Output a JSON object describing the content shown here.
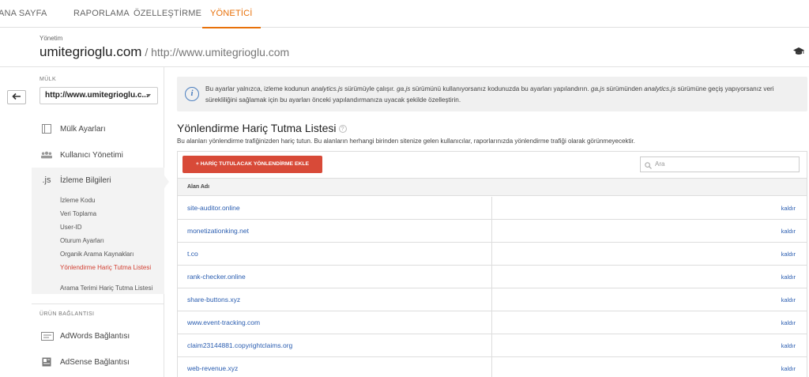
{
  "topnav": {
    "tabs": [
      {
        "label": "ANA SAYFA"
      },
      {
        "label": "RAPORLAMA"
      },
      {
        "label": "ÖZELLEŞTİRME"
      },
      {
        "label": "YÖNETİCİ",
        "active": true
      }
    ]
  },
  "header": {
    "breadcrumb": "Yönetim",
    "account": "umitegrioglu.com",
    "separator": " / ",
    "property_url": "http://www.umitegrioglu.com"
  },
  "sidebar": {
    "property_label": "MÜLK",
    "property_select": "http://www.umitegrioglu.c...",
    "items": [
      {
        "label": "Mülk Ayarları",
        "icon": "property-settings-icon"
      },
      {
        "label": "Kullanıcı Yönetimi",
        "icon": "users-icon"
      },
      {
        "label": "İzleme Bilgileri",
        "icon": "js-icon",
        "icon_text": ".js",
        "selected": true
      }
    ],
    "subitems": [
      {
        "label": "İzleme Kodu"
      },
      {
        "label": "Veri Toplama"
      },
      {
        "label": "User-ID"
      },
      {
        "label": "Oturum Ayarları"
      },
      {
        "label": "Organik Arama Kaynakları"
      },
      {
        "label": "Yönlendirme Hariç Tutma Listesi",
        "active": true
      },
      {
        "label": "Arama Terimi Hariç Tutma Listesi"
      }
    ],
    "product_links_label": "ÜRÜN BAĞLANTISI",
    "product_links": [
      {
        "label": "AdWords Bağlantısı",
        "icon": "adwords-icon"
      },
      {
        "label": "AdSense Bağlantısı",
        "icon": "adsense-icon"
      }
    ]
  },
  "info": {
    "part1": "Bu ayarlar yalnızca, izleme kodunun ",
    "em1": "analytics.js",
    "part2": " sürümüyle çalışır. ",
    "em2": "ga.js",
    "part3": " sürümünü kullanıyorsanız kodunuzda bu ayarları yapılandırın. ",
    "em3": "ga.js",
    "part4": " sürümünden ",
    "em4": "analytics.js",
    "part5": " sürümüne geçiş yapıyorsanız veri sürekliliğini sağlamak için bu ayarları önceki yapılandırmanıza uyacak şekilde özelleştirin."
  },
  "list": {
    "title": "Yönlendirme Hariç Tutma Listesi",
    "help": "?",
    "description": "Bu alanları yönlendirme trafiğinizden hariç tutun. Bu alanların herhangi birinden sitenize gelen kullanıcılar, raporlarınızda yönlendirme trafiği olarak görünmeyecektir.",
    "add_button": "+ HARİÇ TUTULACAK YÖNLENDİRME EKLE",
    "search_placeholder": "Ara",
    "column_header": "Alan Adı",
    "remove_label": "kaldır",
    "rows": [
      {
        "domain": "site-auditor.online"
      },
      {
        "domain": "monetizationking.net"
      },
      {
        "domain": "t.co"
      },
      {
        "domain": "rank-checker.online"
      },
      {
        "domain": "share-buttons.xyz"
      },
      {
        "domain": "www.event-tracking.com"
      },
      {
        "domain": "claim23144881.copyrightclaims.org"
      },
      {
        "domain": "web-revenue.xyz"
      }
    ]
  },
  "colors": {
    "accent": "#e8710a",
    "add_button": "#d84a38",
    "link": "#2a5db0",
    "active_subitem": "#d23f31"
  }
}
